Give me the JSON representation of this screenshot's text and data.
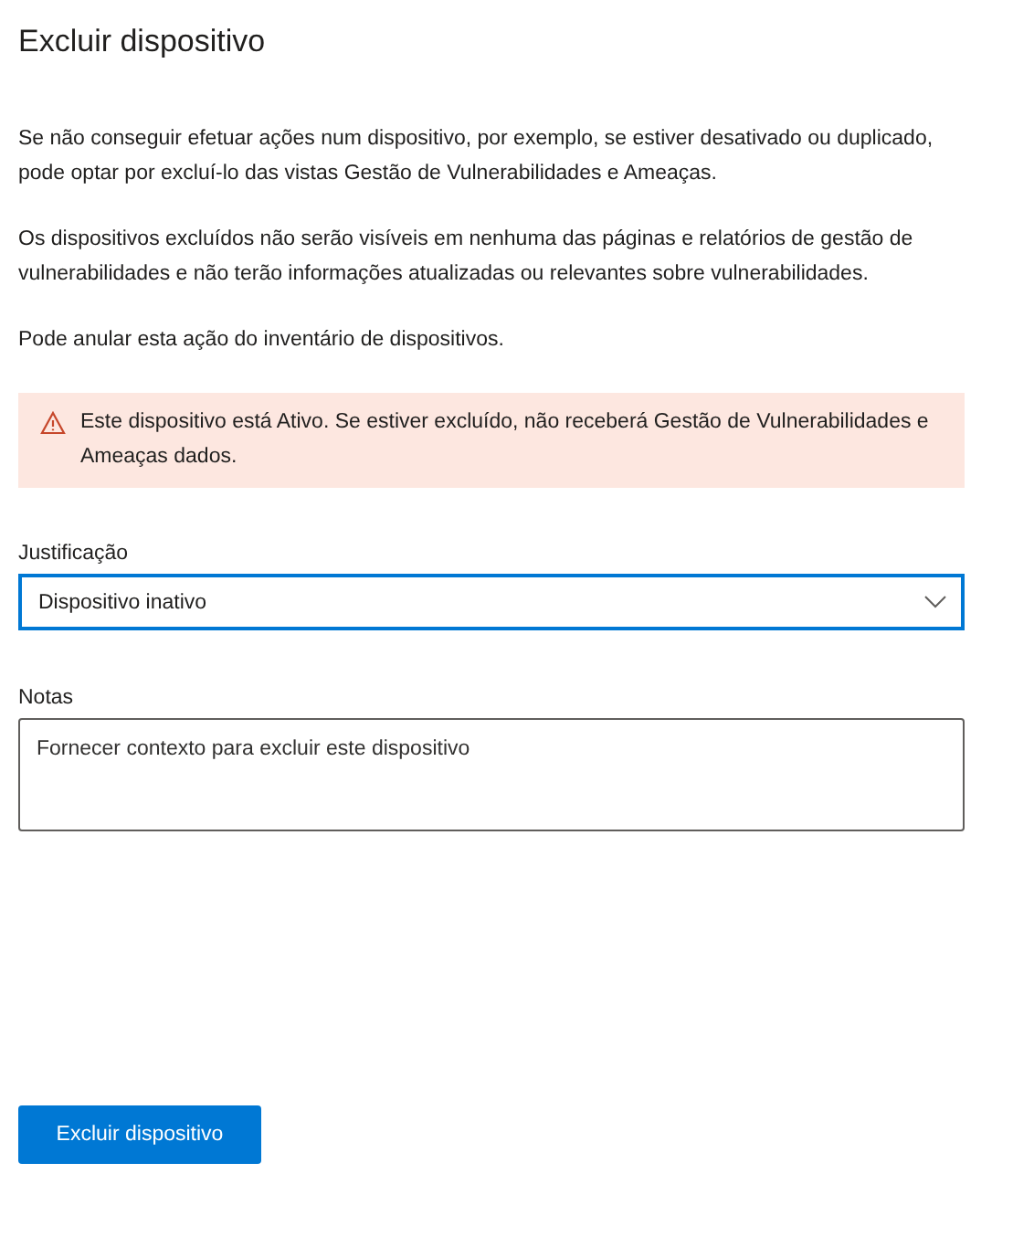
{
  "title": "Excluir dispositivo",
  "paragraphs": [
    "Se não conseguir efetuar ações num dispositivo, por exemplo, se estiver desativado ou duplicado, pode optar por excluí-lo das vistas Gestão de Vulnerabilidades e Ameaças.",
    "Os dispositivos excluídos não serão visíveis em nenhuma das páginas e relatórios de gestão de vulnerabilidades e não terão informações atualizadas ou relevantes sobre vulnerabilidades.",
    "Pode anular esta ação do inventário de dispositivos."
  ],
  "warning": {
    "text": "Este dispositivo está Ativo. Se estiver excluído, não receberá Gestão de Vulnerabilidades e Ameaças dados."
  },
  "justification": {
    "label": "Justificação",
    "value": "Dispositivo inativo",
    "focused": true
  },
  "notes": {
    "label": "Notas",
    "placeholder": "Fornecer contexto para excluir este dispositivo"
  },
  "button": "Excluir dispositivo"
}
